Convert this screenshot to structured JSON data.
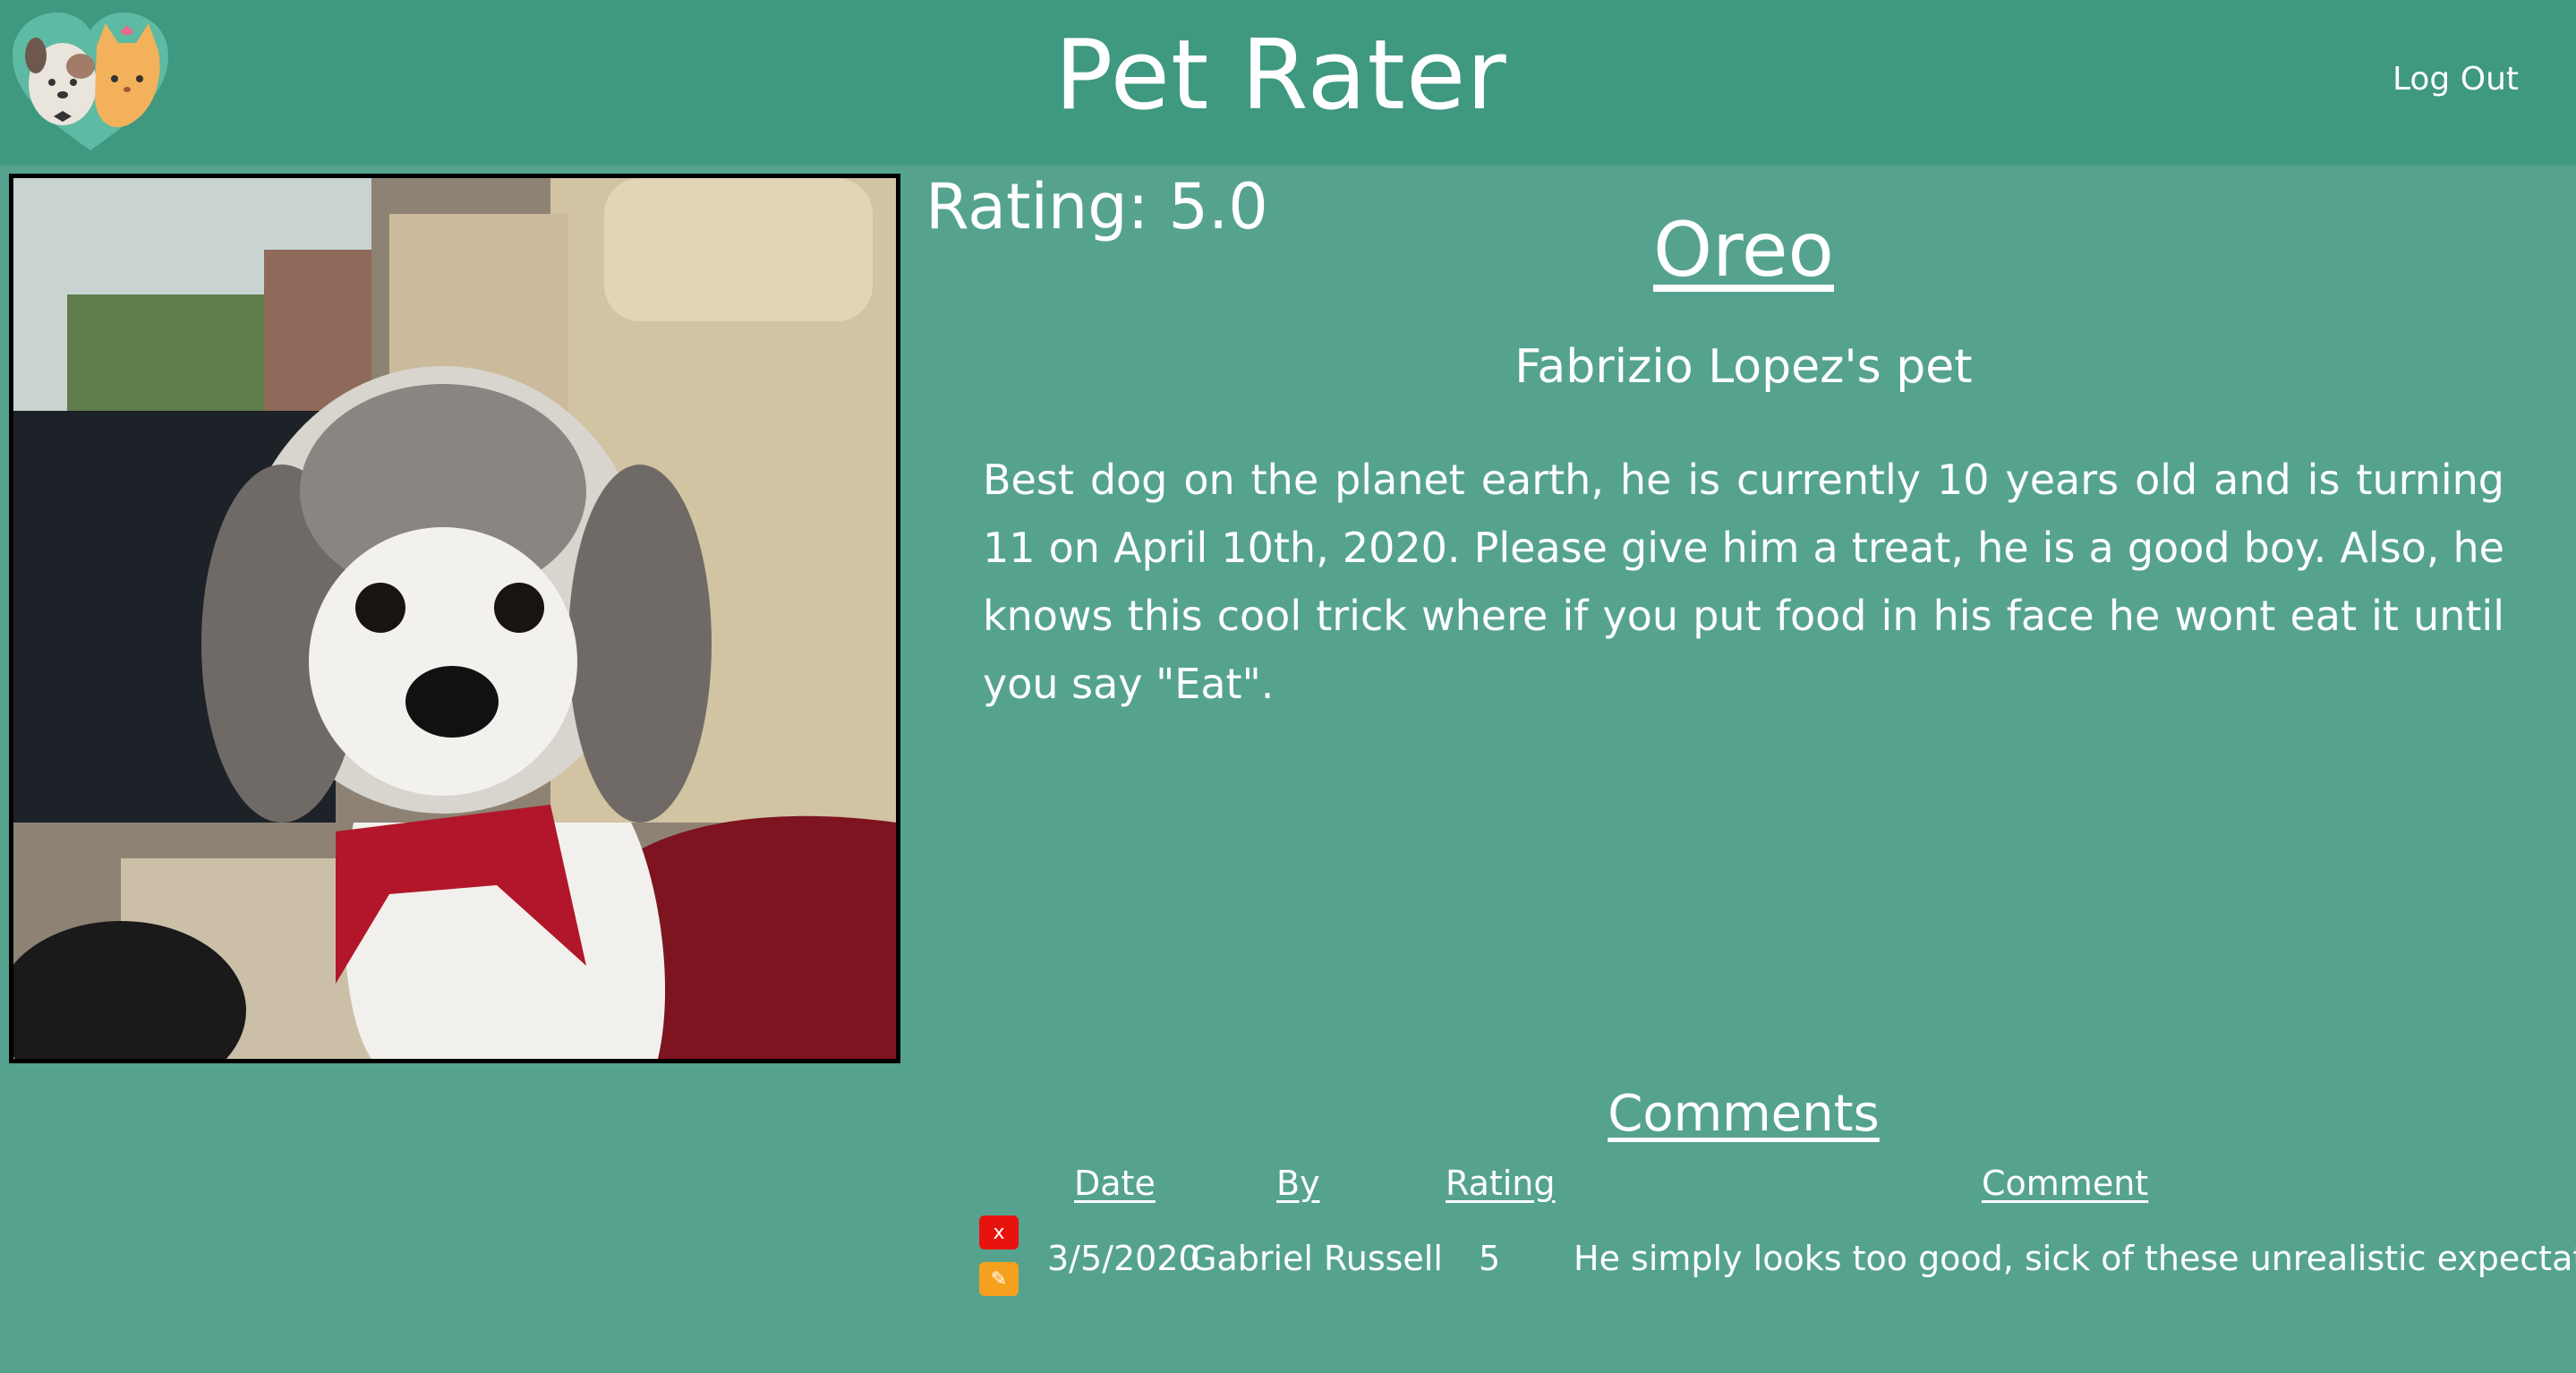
{
  "header": {
    "title": "Pet Rater",
    "logout_label": "Log Out",
    "logo_icon": "dog-and-cat-logo-icon"
  },
  "pet": {
    "rating_label": "Rating: 5.0",
    "name": "Oreo",
    "owner_line": "Fabrizio Lopez's pet",
    "description": "Best dog on the planet earth, he is currently 10 years old and is turning 11 on April 10th, 2020. Please give him a treat, he is a good boy. Also, he knows this cool trick where if you put food in his face he wont eat it until you say \"Eat\"."
  },
  "comments": {
    "title": "Comments",
    "columns": [
      "Date",
      "By",
      "Rating",
      "Comment"
    ],
    "rows": [
      {
        "date": "3/5/2020",
        "by": "Gabriel Russell",
        "rating": "5",
        "comment": "He simply looks too good, sick of these unrealistic expectations.",
        "delete_label": "x",
        "edit_label": "✎"
      }
    ]
  },
  "colors": {
    "page_bg": "#55a38e",
    "header_bg": "#3f9880",
    "delete_button": "#e8130f",
    "edit_button": "#f5a11f"
  }
}
